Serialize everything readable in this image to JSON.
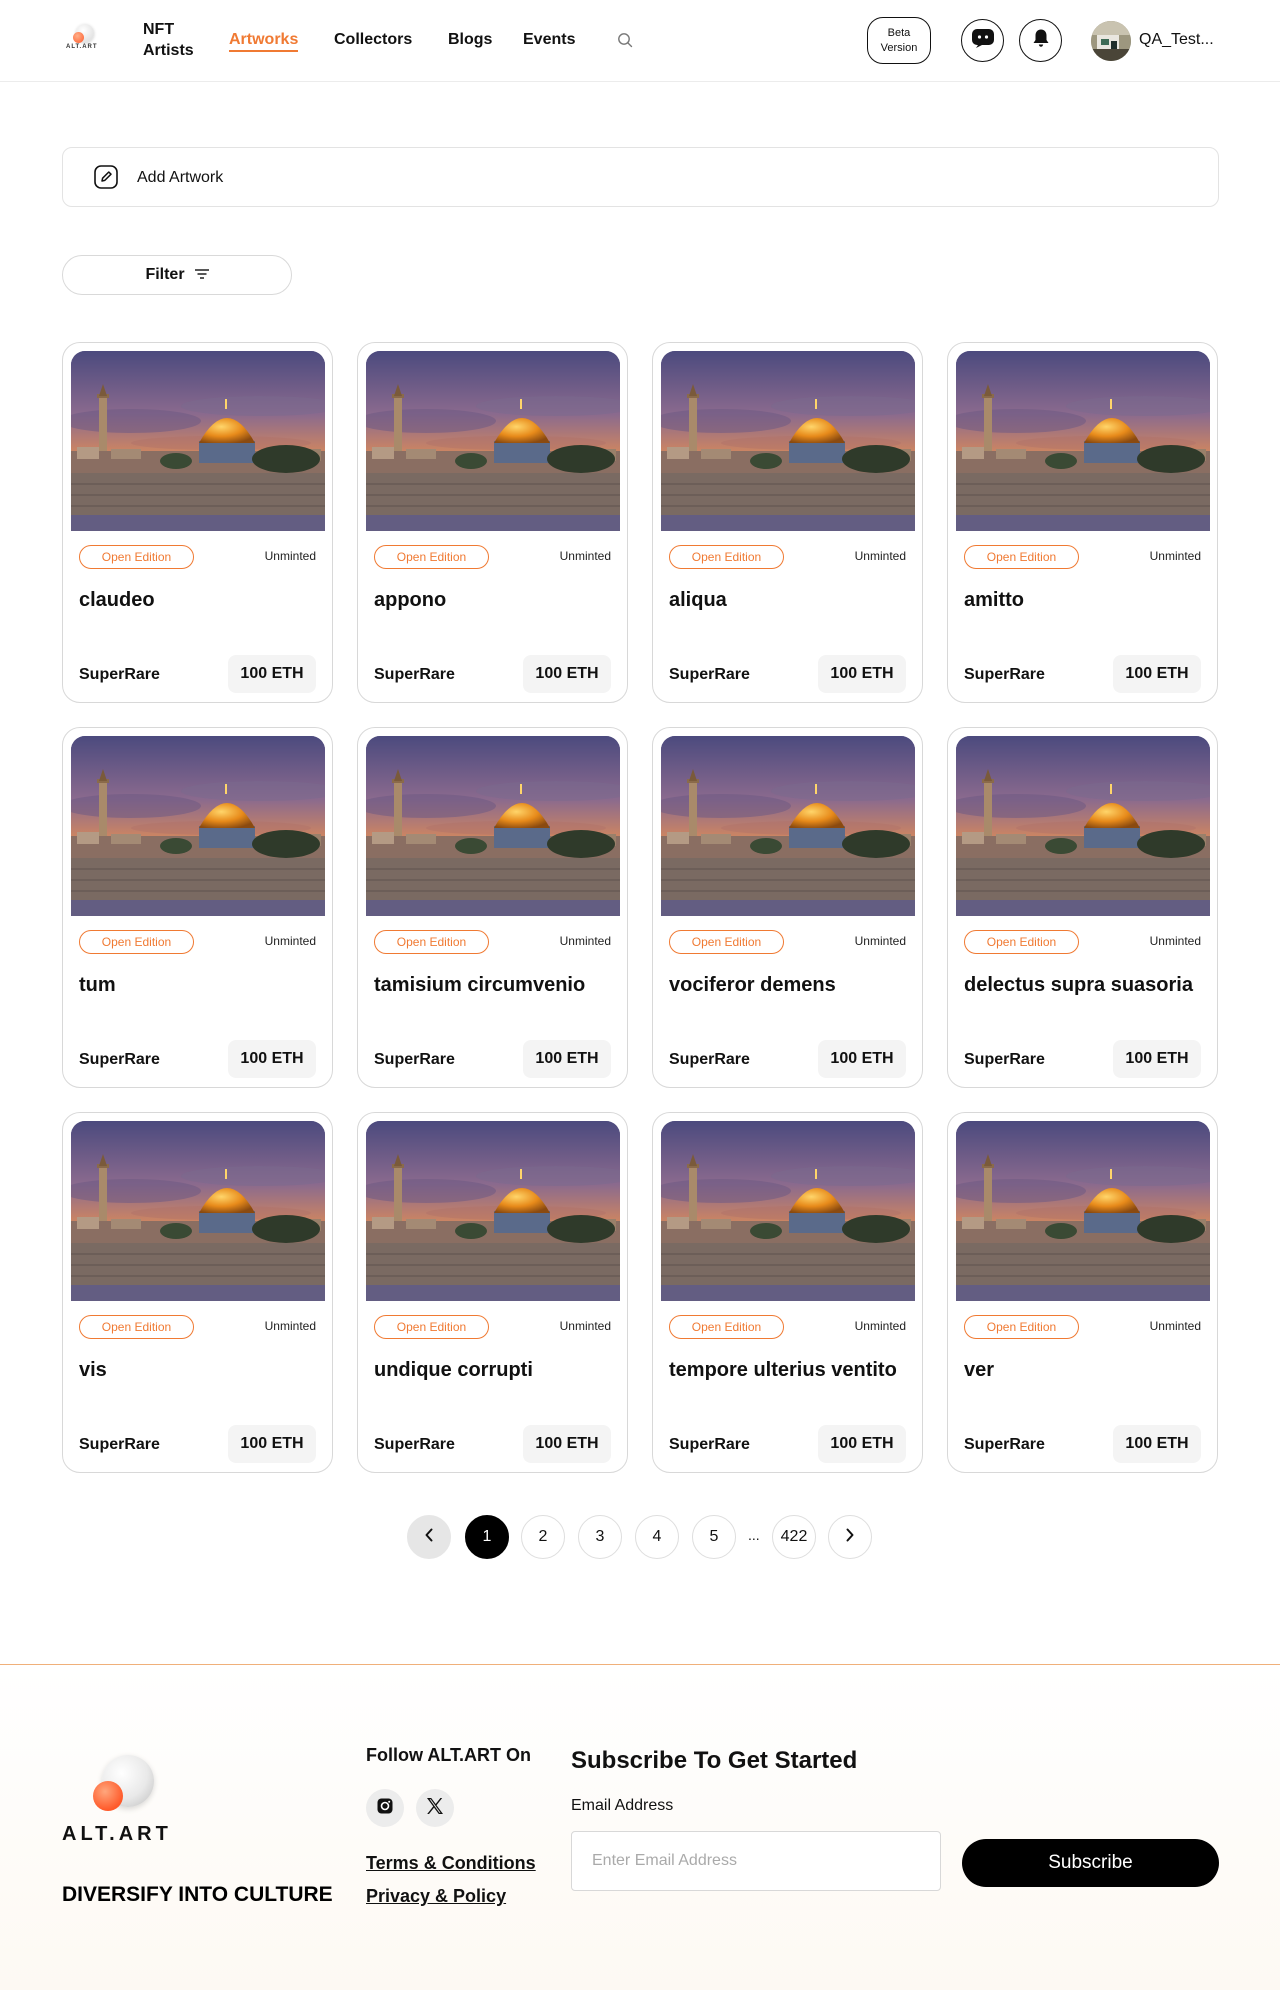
{
  "header": {
    "logo_text": "ALT.ART",
    "nft_artists_line1": "NFT",
    "nft_artists_line2": "Artists",
    "nav": [
      {
        "label": "Artworks",
        "active": true
      },
      {
        "label": "Collectors",
        "active": false
      },
      {
        "label": "Blogs",
        "active": false
      },
      {
        "label": "Events",
        "active": false
      }
    ],
    "search_icon": "search-icon",
    "beta_line1": "Beta",
    "beta_line2": "Version",
    "chat_icon": "chat-icon",
    "bell_icon": "bell-icon",
    "username": "QA_Test..."
  },
  "add_artwork": {
    "label": "Add Artwork",
    "icon": "edit-icon"
  },
  "filter": {
    "label": "Filter",
    "icon": "filter-lines-icon"
  },
  "artworks": [
    {
      "title": "claudeo",
      "edition": "Open Edition",
      "supply": "Unminted",
      "platform": "SuperRare",
      "price": "100 ETH"
    },
    {
      "title": "appono",
      "edition": "Open Edition",
      "supply": "Unminted",
      "platform": "SuperRare",
      "price": "100 ETH"
    },
    {
      "title": "aliqua",
      "edition": "Open Edition",
      "supply": "Unminted",
      "platform": "SuperRare",
      "price": "100 ETH"
    },
    {
      "title": "amitto",
      "edition": "Open Edition",
      "supply": "Unminted",
      "platform": "SuperRare",
      "price": "100 ETH"
    },
    {
      "title": "tum",
      "edition": "Open Edition",
      "supply": "Unminted",
      "platform": "SuperRare",
      "price": "100 ETH"
    },
    {
      "title": "tamisium circumvenio",
      "edition": "Open Edition",
      "supply": "Unminted",
      "platform": "SuperRare",
      "price": "100 ETH"
    },
    {
      "title": "vociferor demens",
      "edition": "Open Edition",
      "supply": "Unminted",
      "platform": "SuperRare",
      "price": "100 ETH"
    },
    {
      "title": "delectus supra suasoria",
      "edition": "Open Edition",
      "supply": "Unminted",
      "platform": "SuperRare",
      "price": "100 ETH"
    },
    {
      "title": "vis",
      "edition": "Open Edition",
      "supply": "Unminted",
      "platform": "SuperRare",
      "price": "100 ETH"
    },
    {
      "title": "undique corrupti",
      "edition": "Open Edition",
      "supply": "Unminted",
      "platform": "SuperRare",
      "price": "100 ETH"
    },
    {
      "title": "tempore ulterius ventito",
      "edition": "Open Edition",
      "supply": "Unminted",
      "platform": "SuperRare",
      "price": "100 ETH"
    },
    {
      "title": "ver",
      "edition": "Open Edition",
      "supply": "Unminted",
      "platform": "SuperRare",
      "price": "100 ETH"
    }
  ],
  "pagination": {
    "prev_icon": "chevron-left-icon",
    "next_icon": "chevron-right-icon",
    "pages": [
      "1",
      "2",
      "3",
      "4",
      "5"
    ],
    "current": "1",
    "ellipsis": "...",
    "last": "422"
  },
  "footer": {
    "logo_text": "ALT.ART",
    "tagline": "DIVERSIFY INTO CULTURE",
    "follow_title": "Follow ALT.ART On",
    "social_icons": [
      "instagram-icon",
      "x-icon"
    ],
    "terms_link": "Terms & Conditions",
    "privacy_link": "Privacy & Policy",
    "subscribe_title": "Subscribe To Get Started",
    "email_label": "Email Address",
    "email_placeholder": "Enter Email Address",
    "email_value": "",
    "subscribe_button": "Subscribe"
  },
  "colors": {
    "accent": "#f07a33",
    "primary": "#000000"
  }
}
